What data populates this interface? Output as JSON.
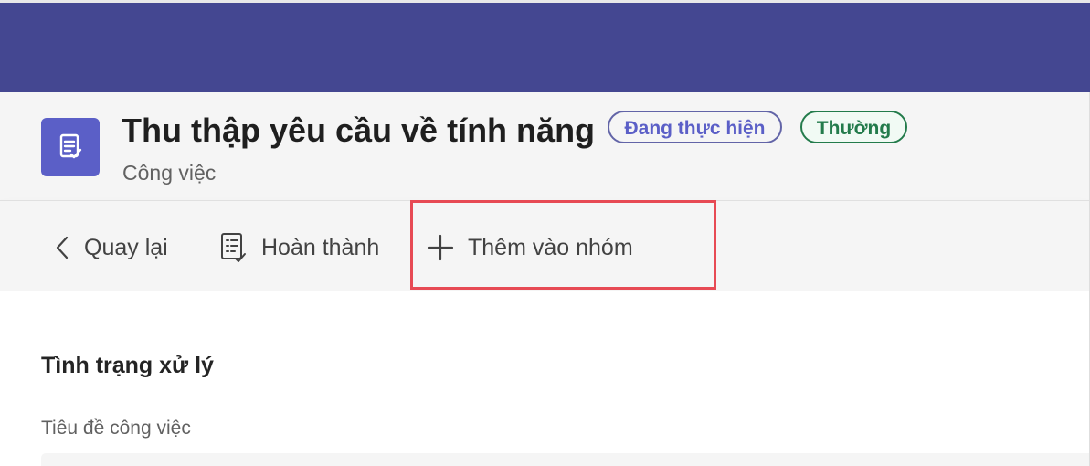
{
  "header": {
    "title": "Thu thập yêu cầu về tính năng",
    "subtitle": "Công việc",
    "app_icon": "task-list-icon",
    "status_badge": "Đang thực hiện",
    "priority_badge": "Thường",
    "colors": {
      "top_bar": "#444791",
      "app_tile": "#5b5fc7",
      "status_border": "#6264a7",
      "priority_border": "#237b4b"
    }
  },
  "toolbar": {
    "back_label": "Quay lại",
    "back_icon": "chevron-left-icon",
    "complete_label": "Hoàn thành",
    "complete_icon": "checklist-icon",
    "add_label": "Thêm vào nhóm",
    "add_icon": "plus-icon",
    "highlight_color": "#e74a54"
  },
  "main": {
    "section_title": "Tình trạng xử lý",
    "field_label": "Tiêu đề công việc",
    "field_value": ""
  }
}
